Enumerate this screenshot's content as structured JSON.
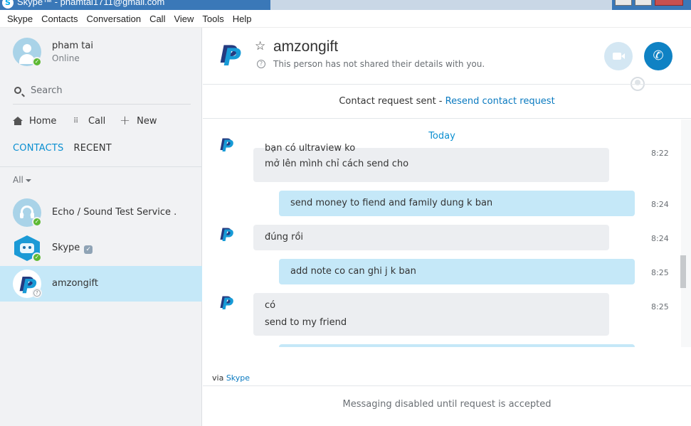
{
  "window": {
    "title": "Skype™ - phamtai1711@gmail.com"
  },
  "menu": [
    "Skype",
    "Contacts",
    "Conversation",
    "Call",
    "View",
    "Tools",
    "Help"
  ],
  "profile": {
    "name": "pham tai",
    "status": "Online"
  },
  "search": {
    "label": "Search"
  },
  "nav": {
    "home": "Home",
    "call": "Call",
    "new": "New"
  },
  "tabs": {
    "contacts": "CONTACTS",
    "recent": "RECENT"
  },
  "filter": {
    "label": "All"
  },
  "contacts": [
    {
      "name": "Echo / Sound Test Service .",
      "status": "online"
    },
    {
      "name": "Skype",
      "status": "online",
      "verified": true
    },
    {
      "name": "amzongift",
      "status": "unknown",
      "selected": true
    }
  ],
  "chat_header": {
    "name": "amzongift",
    "subtitle": "This person has not shared their details with you."
  },
  "request": {
    "text": "Contact request sent - ",
    "link": "Resend contact request"
  },
  "conversation": {
    "day_label": "Today",
    "messages": [
      {
        "direction": "in",
        "lines": [
          "bạn có ultraview ko",
          "mở lên mình chỉ cách send cho"
        ],
        "time": "8:22"
      },
      {
        "direction": "out",
        "lines": [
          "send money to fiend and family dung k ban"
        ],
        "time": "8:24"
      },
      {
        "direction": "in",
        "lines": [
          "đúng rồi"
        ],
        "time": "8:24"
      },
      {
        "direction": "out",
        "lines": [
          "add note co can ghi j k ban"
        ],
        "time": "8:25"
      },
      {
        "direction": "in",
        "lines": [
          "có",
          "send to my friend"
        ],
        "time": "8:25"
      }
    ]
  },
  "via": {
    "prefix": "via ",
    "link": "Skype"
  },
  "composer": {
    "disabled_note": "Messaging disabled until request is accepted"
  },
  "colors": {
    "accent": "#0a8fd1",
    "call_button": "#0f82c4",
    "selected_contact": "#c5e8f8",
    "outgoing_bubble": "#c5e8f8",
    "incoming_bubble": "#eceef1",
    "online": "#5eb933",
    "paypal_dark": "#253b80",
    "paypal_light": "#179bd7"
  }
}
